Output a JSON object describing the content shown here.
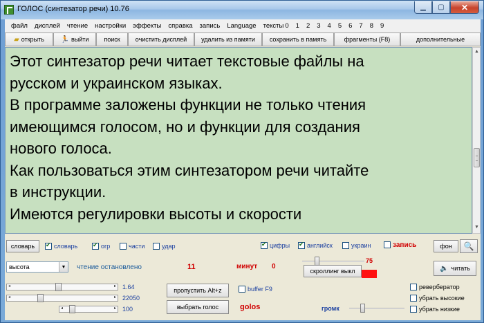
{
  "window": {
    "title": "ГОЛОС (синтезатор речи) 10.76"
  },
  "menu": [
    "файл",
    "дисплей",
    "чтение",
    "настройки",
    "эффекты",
    "справка",
    "запись",
    "Language",
    "тексты"
  ],
  "menu_numbers": [
    "0",
    "1",
    "2",
    "3",
    "4",
    "5",
    "6",
    "7",
    "8",
    "9"
  ],
  "toolbar": {
    "open": "открыть",
    "exit": "выйти",
    "search": "поиск",
    "clear": "очистить дисплей",
    "delete_mem": "удалить из памяти",
    "save_mem": "сохранить в память",
    "fragments": "фрагменты (F8)",
    "extra": "дополнительные"
  },
  "text_lines": [
    "Этот синтезатор речи читает текстовые файлы на",
    "русском и украинском языках.",
    "В программе заложены функции не только чтения",
    "имеющимся голосом, но и функции для создания",
    "нового голоса.",
    "Как пользоваться этим синтезатором речи читайте",
    "в инструкции.",
    "Имеются регулировки высоты и скорости"
  ],
  "options": {
    "dict_button": "словарь",
    "cb_dict": "словарь",
    "cb_ogr": "огр",
    "cb_parts": "части",
    "cb_stress": "удар",
    "cb_digits": "цифры",
    "cb_english": "английск",
    "cb_ukrain": "украин",
    "record": "запись",
    "bg_button": "фон"
  },
  "controls": {
    "param_select": "высота",
    "status": "чтение остановлено",
    "count": "11",
    "minutes_label": "минут",
    "minutes_value": "0",
    "scroll_value": "75",
    "scroll_button": "скроллинг выкл",
    "read_button": "читать",
    "slider1_value": "1.64",
    "slider2_value": "22050",
    "slider3_value": "100",
    "skip_button": "пропустить Alt+z",
    "choose_voice": "выбрать голос",
    "buffer": "buffer F9",
    "voice_name": "golos",
    "volume_label": "громк",
    "reverb": "ревербератор",
    "remove_high": "убрать высокие",
    "remove_low": "убрать низкие"
  },
  "colors": {
    "text_bg": "#c7e0c0",
    "red": "#d00000",
    "blue_label": "#1a3fa0"
  }
}
